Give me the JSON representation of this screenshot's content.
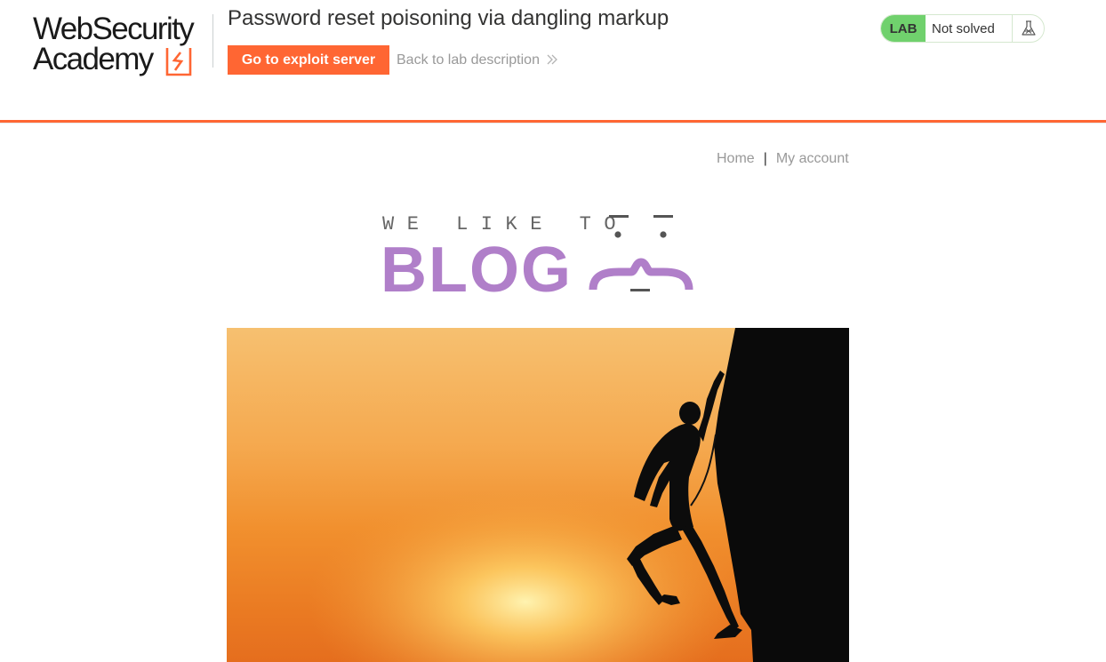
{
  "academy_header": {
    "logo": {
      "line1": "WebSecurity",
      "line2": "Academy"
    },
    "lab_title": "Password reset poisoning via dangling markup",
    "exploit_button": "Go to exploit server",
    "back_link": "Back to lab description",
    "lab_status": {
      "badge": "LAB",
      "status": "Not solved"
    },
    "colors": {
      "accent": "#ff6633",
      "lab_badge": "#70d16d"
    },
    "icons": [
      "chevrons-right-icon",
      "flask-icon"
    ]
  },
  "nav": {
    "home": "Home",
    "separator": "|",
    "my_account": "My account"
  },
  "banner": {
    "tagline": "WE LIKE TO",
    "word": "BLOG",
    "color": "#b07fc9"
  },
  "hero_image": {
    "subject": "rock climber silhouette at sunset"
  }
}
